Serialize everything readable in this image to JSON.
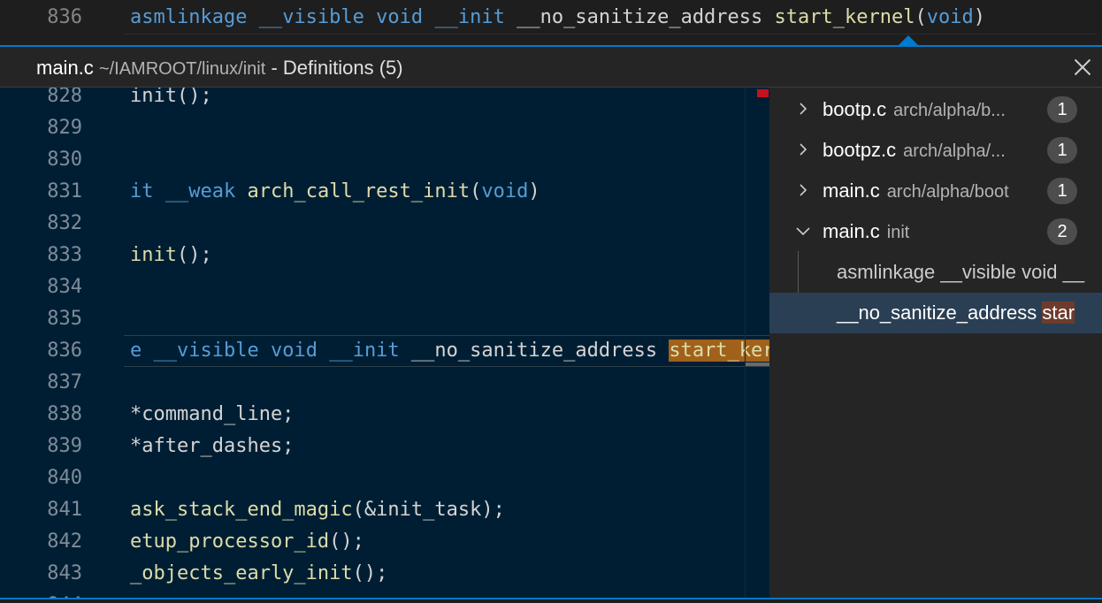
{
  "top_line": {
    "line_number": "836",
    "tokens": [
      {
        "t": "asmlinkage",
        "c": "kw"
      },
      {
        "t": " ",
        "c": ""
      },
      {
        "t": "__visible",
        "c": "kw"
      },
      {
        "t": " ",
        "c": ""
      },
      {
        "t": "void",
        "c": "kw"
      },
      {
        "t": " ",
        "c": ""
      },
      {
        "t": "__init",
        "c": "kw"
      },
      {
        "t": " __no_sanitize_address ",
        "c": ""
      },
      {
        "t": "start_kernel",
        "c": "fn"
      },
      {
        "t": "(",
        "c": ""
      },
      {
        "t": "void",
        "c": "kw"
      },
      {
        "t": ")",
        "c": ""
      }
    ]
  },
  "peek_header": {
    "file_name": "main.c",
    "path": "~/IAMROOT/linux/init",
    "meta": "- Definitions (5)"
  },
  "editor": {
    "lines": [
      {
        "n": "828",
        "tokens": [
          {
            "t": "init();",
            "c": ""
          }
        ]
      },
      {
        "n": "829",
        "tokens": []
      },
      {
        "n": "830",
        "tokens": []
      },
      {
        "n": "831",
        "tokens": [
          {
            "t": "it ",
            "c": "kw"
          },
          {
            "t": "__weak",
            "c": "kw"
          },
          {
            "t": " ",
            "c": ""
          },
          {
            "t": "arch_call_rest_init",
            "c": "fn"
          },
          {
            "t": "(",
            "c": ""
          },
          {
            "t": "void",
            "c": "kw"
          },
          {
            "t": ")",
            "c": ""
          }
        ]
      },
      {
        "n": "832",
        "tokens": []
      },
      {
        "n": "833",
        "tokens": [
          {
            "t": "init",
            "c": "fn"
          },
          {
            "t": "();",
            "c": ""
          }
        ]
      },
      {
        "n": "834",
        "tokens": []
      },
      {
        "n": "835",
        "tokens": []
      },
      {
        "n": "836",
        "current": true,
        "tokens": [
          {
            "t": "e ",
            "c": "kw"
          },
          {
            "t": "__visible",
            "c": "kw"
          },
          {
            "t": " ",
            "c": ""
          },
          {
            "t": "void",
            "c": "kw"
          },
          {
            "t": " ",
            "c": ""
          },
          {
            "t": "__init",
            "c": "kw"
          },
          {
            "t": " __no_sanitize_address ",
            "c": ""
          },
          {
            "t": "start_kernel",
            "c": "match"
          }
        ]
      },
      {
        "n": "837",
        "tokens": []
      },
      {
        "n": "838",
        "tokens": [
          {
            "t": "*command_line;",
            "c": ""
          }
        ]
      },
      {
        "n": "839",
        "tokens": [
          {
            "t": "*after_dashes;",
            "c": ""
          }
        ]
      },
      {
        "n": "840",
        "tokens": []
      },
      {
        "n": "841",
        "tokens": [
          {
            "t": "ask_stack_end_magic",
            "c": "fn"
          },
          {
            "t": "(&init_task);",
            "c": ""
          }
        ]
      },
      {
        "n": "842",
        "tokens": [
          {
            "t": "etup_processor_id",
            "c": "fn"
          },
          {
            "t": "();",
            "c": ""
          }
        ]
      },
      {
        "n": "843",
        "tokens": [
          {
            "t": "_objects_early_init",
            "c": "fn"
          },
          {
            "t": "();",
            "c": ""
          }
        ]
      },
      {
        "n": "844",
        "tokens": []
      }
    ]
  },
  "references": {
    "items": [
      {
        "file": "bootp.c",
        "dir": "arch/alpha/b...",
        "count": "1",
        "expanded": false
      },
      {
        "file": "bootpz.c",
        "dir": "arch/alpha/...",
        "count": "1",
        "expanded": false
      },
      {
        "file": "main.c",
        "dir": "arch/alpha/boot",
        "count": "1",
        "expanded": false
      },
      {
        "file": "main.c",
        "dir": "init",
        "count": "2",
        "expanded": true
      }
    ],
    "children": [
      {
        "text": "asmlinkage __visible void __",
        "match": "",
        "selected": false
      },
      {
        "text": "__no_sanitize_address ",
        "match": "star",
        "selected": true
      }
    ]
  }
}
